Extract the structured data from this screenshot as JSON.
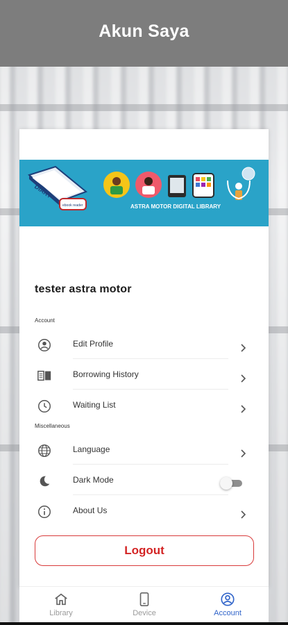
{
  "header": {
    "title": "Akun Saya"
  },
  "banner": {
    "logo_text": "DIARY",
    "logo_subtext": "ebook reader",
    "caption": "ASTRA MOTOR DIGITAL LIBRARY",
    "background": "#2aa3c8"
  },
  "profile": {
    "name": "tester astra motor"
  },
  "sections": {
    "account": "Account",
    "misc": "Miscellaneous"
  },
  "menu": {
    "edit_profile": "Edit Profile",
    "borrowing_history": "Borrowing History",
    "waiting_list": "Waiting List",
    "language": "Language",
    "dark_mode": "Dark Mode",
    "about_us": "About Us"
  },
  "dark_mode_enabled": false,
  "logout": {
    "label": "Logout",
    "color": "#d32424"
  },
  "nav": {
    "library": "Library",
    "device": "Device",
    "account": "Account",
    "active": "account",
    "active_color": "#2f63c9"
  }
}
